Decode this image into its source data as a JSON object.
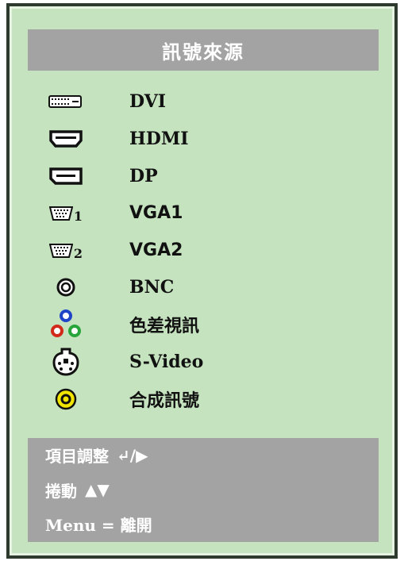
{
  "menu": {
    "title": "訊號來源",
    "items": [
      {
        "label": "DVI",
        "icon": "dvi-port-icon"
      },
      {
        "label": "HDMI",
        "icon": "hdmi-port-icon"
      },
      {
        "label": "DP",
        "icon": "displayport-icon"
      },
      {
        "label": "VGA1",
        "icon": "vga-port-icon",
        "icon_sub": "1"
      },
      {
        "label": "VGA2",
        "icon": "vga-port-icon",
        "icon_sub": "2"
      },
      {
        "label": "BNC",
        "icon": "bnc-connector-icon"
      },
      {
        "label": "色差視訊",
        "icon": "component-video-icon"
      },
      {
        "label": "S-Video",
        "icon": "s-video-icon"
      },
      {
        "label": "合成訊號",
        "icon": "composite-video-icon"
      }
    ]
  },
  "help": {
    "adjust_label": "項目調整",
    "adjust_symbols": "↵/▶",
    "scroll_label": "捲動",
    "scroll_symbols": "▲▼",
    "menu_label": "Menu = 離開"
  },
  "colors": {
    "panel_bg": "#c6e3bf",
    "bar_bg": "#a3a3a3",
    "frame": "#2f3a2f",
    "component_blue": "#1f44c8",
    "component_red": "#d22a1a",
    "component_green": "#27a53a",
    "composite_yellow": "#f0e400"
  }
}
